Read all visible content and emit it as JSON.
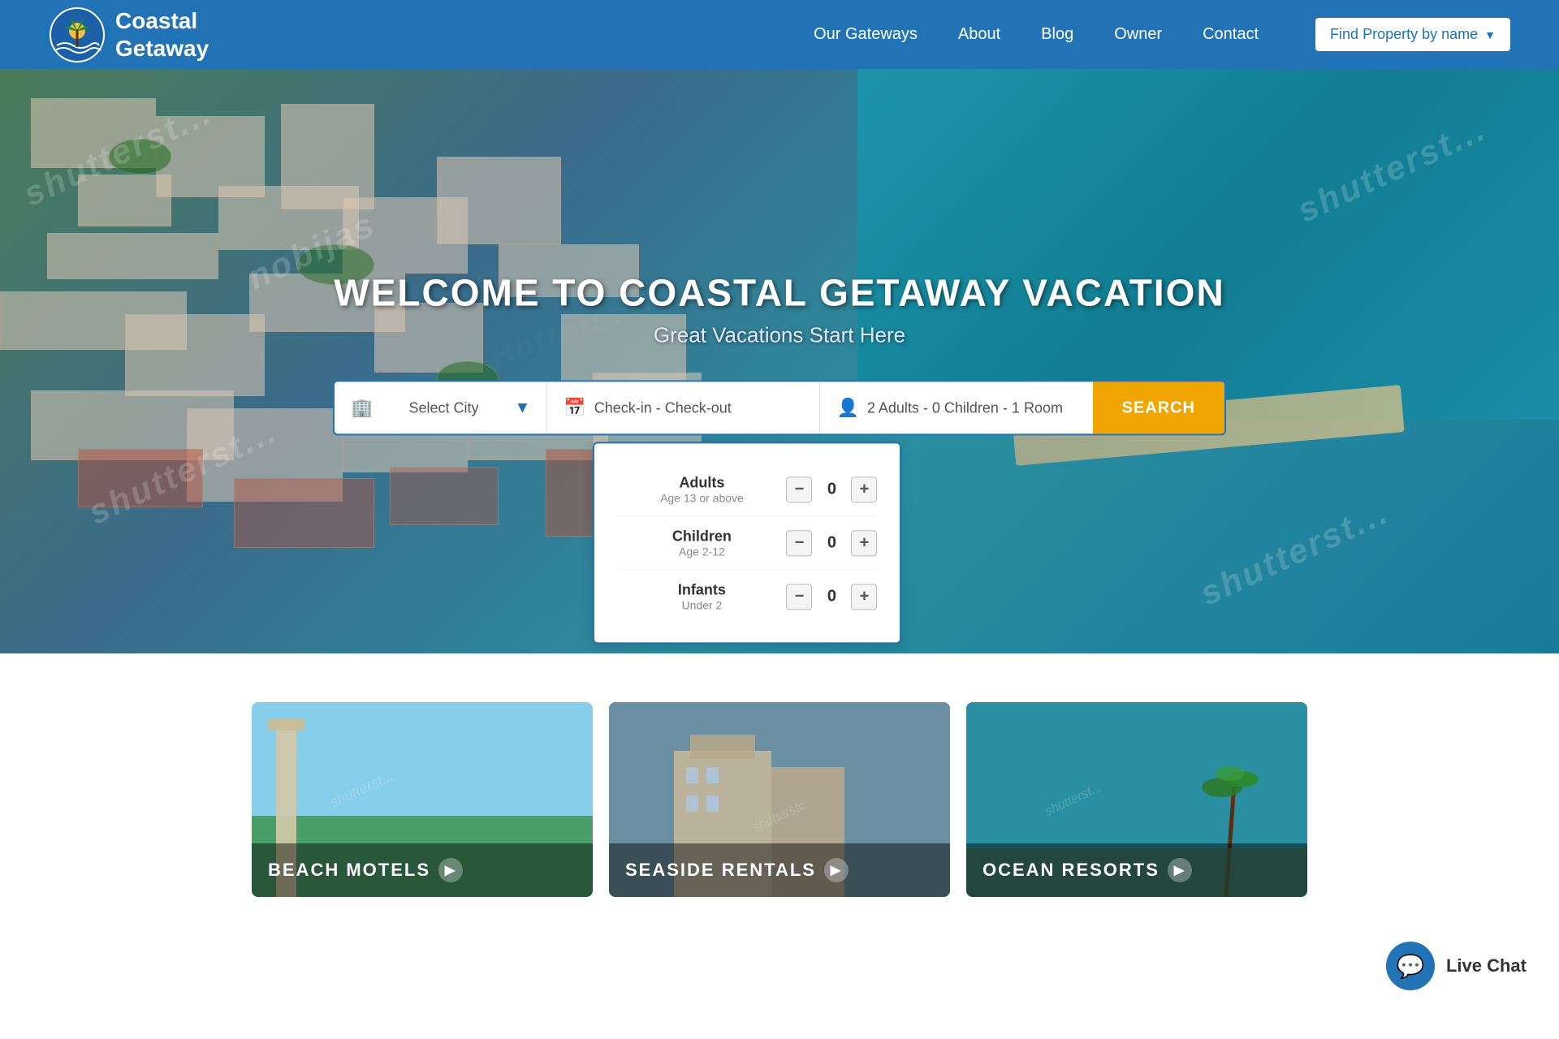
{
  "header": {
    "logo_line1": "Coastal",
    "logo_line2": "Getaway",
    "nav": [
      {
        "label": "Our Gateways",
        "id": "our-gateways"
      },
      {
        "label": "About",
        "id": "about"
      },
      {
        "label": "Blog",
        "id": "blog"
      },
      {
        "label": "Owner",
        "id": "owner"
      },
      {
        "label": "Contact",
        "id": "contact"
      }
    ],
    "find_property_label": "Find Property by name"
  },
  "hero": {
    "title": "WELCOME TO COASTAL GETAWAY VACATION",
    "subtitle": "Great Vacations Start Here",
    "watermarks": [
      "shutterst...",
      "shutterst...",
      "shutterstc",
      "shutterst...",
      "shutterst..."
    ]
  },
  "search": {
    "city_placeholder": "Select City",
    "dates_placeholder": "Check-in  -  Check-out",
    "guests_label": "2 Adults  -  0 Children  -  1 Room",
    "search_btn": "SEARCH"
  },
  "guest_dropdown": {
    "adults": {
      "label": "Adults",
      "sublabel": "Age 13 or above",
      "value": 0
    },
    "children": {
      "label": "Children",
      "sublabel": "Age 2-12",
      "value": 0
    },
    "infants": {
      "label": "Infants",
      "sublabel": "Under 2",
      "value": 0
    }
  },
  "live_chat": {
    "label": "Live Chat"
  },
  "cards": [
    {
      "label": "BEACH MOTELS",
      "bg": "beach"
    },
    {
      "label": "SEASIDE RENTALS",
      "bg": "seaside"
    },
    {
      "label": "OCEAN RESORTS",
      "bg": "ocean"
    }
  ]
}
